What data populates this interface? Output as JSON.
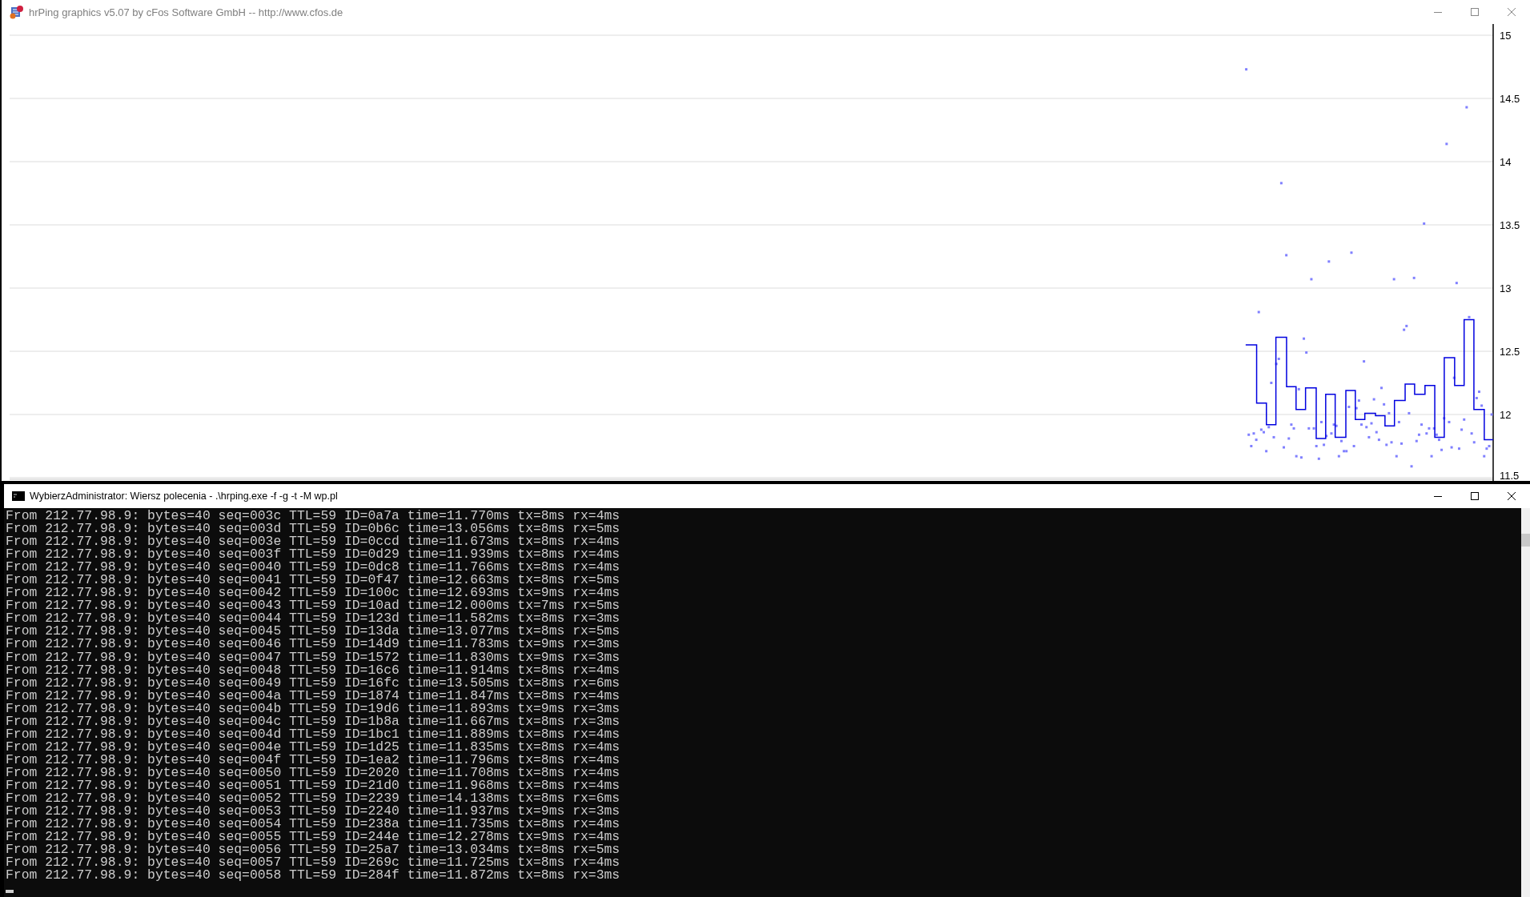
{
  "graph_window": {
    "title": "hrPing graphics v5.07 by cFos Software GmbH -- http://www.cfos.de",
    "y_axis_labels": [
      "15",
      "14.5",
      "14",
      "13.5",
      "13",
      "12.5",
      "12",
      "11.5"
    ]
  },
  "console_window": {
    "title": "WybierzAdministrator: Wiersz polecenia - .\\hrping.exe  -f -g -t -M wp.pl",
    "lines": [
      "From 212.77.98.9: bytes=40 seq=003c TTL=59 ID=0a7a time=11.770ms tx=8ms rx=4ms",
      "From 212.77.98.9: bytes=40 seq=003d TTL=59 ID=0b6c time=13.056ms tx=8ms rx=5ms",
      "From 212.77.98.9: bytes=40 seq=003e TTL=59 ID=0ccd time=11.673ms tx=8ms rx=4ms",
      "From 212.77.98.9: bytes=40 seq=003f TTL=59 ID=0d29 time=11.939ms tx=8ms rx=4ms",
      "From 212.77.98.9: bytes=40 seq=0040 TTL=59 ID=0dc8 time=11.766ms tx=8ms rx=4ms",
      "From 212.77.98.9: bytes=40 seq=0041 TTL=59 ID=0f47 time=12.663ms tx=8ms rx=5ms",
      "From 212.77.98.9: bytes=40 seq=0042 TTL=59 ID=100c time=12.693ms tx=9ms rx=4ms",
      "From 212.77.98.9: bytes=40 seq=0043 TTL=59 ID=10ad time=12.000ms tx=7ms rx=5ms",
      "From 212.77.98.9: bytes=40 seq=0044 TTL=59 ID=123d time=11.582ms tx=8ms rx=3ms",
      "From 212.77.98.9: bytes=40 seq=0045 TTL=59 ID=13da time=13.077ms tx=8ms rx=5ms",
      "From 212.77.98.9: bytes=40 seq=0046 TTL=59 ID=14d9 time=11.783ms tx=9ms rx=3ms",
      "From 212.77.98.9: bytes=40 seq=0047 TTL=59 ID=1572 time=11.830ms tx=9ms rx=3ms",
      "From 212.77.98.9: bytes=40 seq=0048 TTL=59 ID=16c6 time=11.914ms tx=8ms rx=4ms",
      "From 212.77.98.9: bytes=40 seq=0049 TTL=59 ID=16fc time=13.505ms tx=8ms rx=6ms",
      "From 212.77.98.9: bytes=40 seq=004a TTL=59 ID=1874 time=11.847ms tx=8ms rx=4ms",
      "From 212.77.98.9: bytes=40 seq=004b TTL=59 ID=19d6 time=11.893ms tx=9ms rx=3ms",
      "From 212.77.98.9: bytes=40 seq=004c TTL=59 ID=1b8a time=11.667ms tx=8ms rx=3ms",
      "From 212.77.98.9: bytes=40 seq=004d TTL=59 ID=1bc1 time=11.889ms tx=8ms rx=4ms",
      "From 212.77.98.9: bytes=40 seq=004e TTL=59 ID=1d25 time=11.835ms tx=8ms rx=4ms",
      "From 212.77.98.9: bytes=40 seq=004f TTL=59 ID=1ea2 time=11.796ms tx=8ms rx=4ms",
      "From 212.77.98.9: bytes=40 seq=0050 TTL=59 ID=2020 time=11.708ms tx=8ms rx=4ms",
      "From 212.77.98.9: bytes=40 seq=0051 TTL=59 ID=21d0 time=11.968ms tx=8ms rx=4ms",
      "From 212.77.98.9: bytes=40 seq=0052 TTL=59 ID=2239 time=14.138ms tx=8ms rx=6ms",
      "From 212.77.98.9: bytes=40 seq=0053 TTL=59 ID=2240 time=11.937ms tx=9ms rx=3ms",
      "From 212.77.98.9: bytes=40 seq=0054 TTL=59 ID=238a time=11.735ms tx=8ms rx=4ms",
      "From 212.77.98.9: bytes=40 seq=0055 TTL=59 ID=244e time=12.278ms tx=9ms rx=4ms",
      "From 212.77.98.9: bytes=40 seq=0056 TTL=59 ID=25a7 time=13.034ms tx=8ms rx=5ms",
      "From 212.77.98.9: bytes=40 seq=0057 TTL=59 ID=269c time=11.725ms tx=8ms rx=4ms",
      "From 212.77.98.9: bytes=40 seq=0058 TTL=59 ID=284f time=11.872ms tx=8ms rx=3ms"
    ]
  }
}
